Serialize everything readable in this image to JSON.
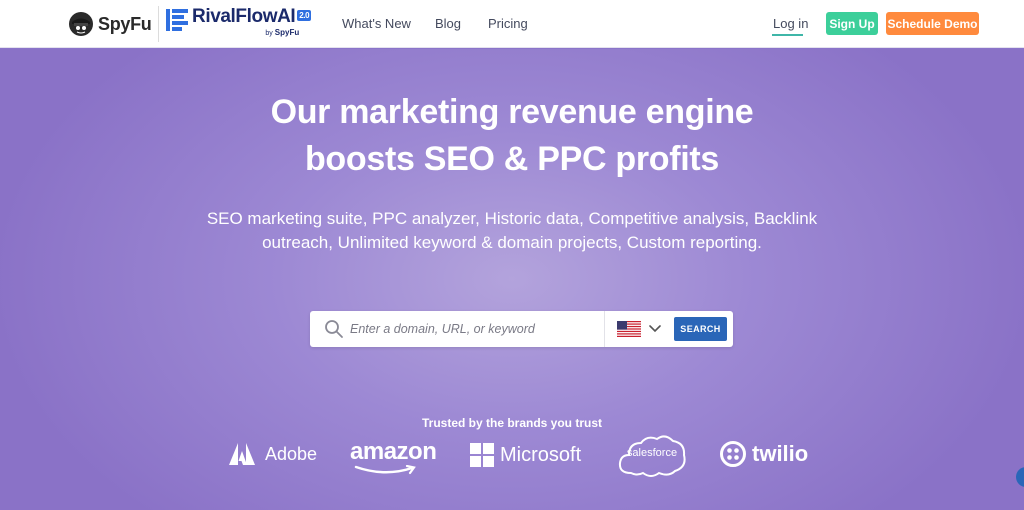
{
  "header": {
    "spyfu_logo_text": "SpyFu",
    "rival_logo_text": "RivalFlowAI",
    "rival_logo_badge": "2.0",
    "rival_logo_by": "by",
    "rival_logo_by_brand": "SpyFu",
    "nav": {
      "whats_new": "What's New",
      "blog": "Blog",
      "pricing": "Pricing"
    },
    "login": "Log in",
    "signup": "Sign Up",
    "schedule_demo": "Schedule Demo"
  },
  "hero": {
    "headline_line1": "Our marketing revenue engine",
    "headline_line2": "boosts SEO & PPC profits",
    "subhead": "SEO marketing suite, PPC analyzer, Historic data, Competitive analysis, Backlink outreach, Unlimited keyword & domain projects, Custom reporting."
  },
  "search": {
    "placeholder": "Enter a domain, URL, or keyword",
    "value": "",
    "country_icon": "us-flag-icon",
    "button_label": "SEARCH"
  },
  "trusted": {
    "label": "Trusted by the brands you trust",
    "brands": {
      "adobe": "Adobe",
      "amazon": "amazon",
      "microsoft": "Microsoft",
      "salesforce": "salesforce",
      "twilio": "twilio"
    }
  },
  "colors": {
    "hero_bg": "#8a74c9",
    "signup": "#3ccf9a",
    "demo": "#ff8a3d",
    "search_button": "#2a66b8",
    "login_underline": "#3fb6a8"
  }
}
